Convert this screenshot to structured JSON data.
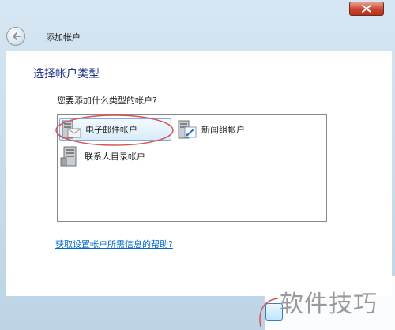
{
  "window": {
    "title": "添加帐户"
  },
  "page": {
    "heading": "选择帐户类型",
    "question": "您要添加什么类型的帐户?",
    "help_link": "获取设置帐户所需信息的帮助?"
  },
  "account_types": [
    {
      "label": "电子邮件帐户",
      "icon": "email-server-icon",
      "selected": true
    },
    {
      "label": "新闻组帐户",
      "icon": "newsgroup-server-icon",
      "selected": false
    },
    {
      "label": "联系人目录帐户",
      "icon": "directory-server-icon",
      "selected": false
    }
  ],
  "watermark": {
    "text": "软件技巧"
  },
  "colors": {
    "heading": "#1e3287",
    "link": "#0066cc",
    "annotation": "#d9534f",
    "selection": "#d9ecf9"
  }
}
